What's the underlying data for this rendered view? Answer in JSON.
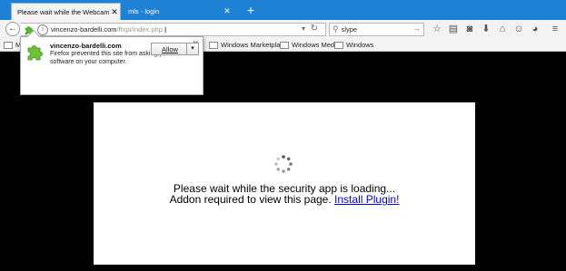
{
  "tabs": [
    {
      "title": "Please wait while the Webcam is lo...",
      "active": true
    },
    {
      "title": "mls - login",
      "active": false
    }
  ],
  "navbar": {
    "url_domain": "vincenzo-bardelli.com",
    "url_path": "/ffxpi/index.php",
    "search_value": "slype"
  },
  "bookmarks": {
    "items": [
      "M",
      "Windows Marketplace",
      "Windows Media",
      "Windows"
    ]
  },
  "doorhanger": {
    "title": "vincenzo-bardelli.com",
    "message": "Firefox prevented this site from asking you to install software on your computer.",
    "allow_label": "Allow"
  },
  "page": {
    "line1": "Please wait while the security app is loading...",
    "line2": "Addon required to view this page.",
    "link": "Install Plugin!"
  },
  "colors": {
    "tabstrip": "#1d82d6",
    "page_background": "#000000",
    "link": "#0000ee"
  }
}
